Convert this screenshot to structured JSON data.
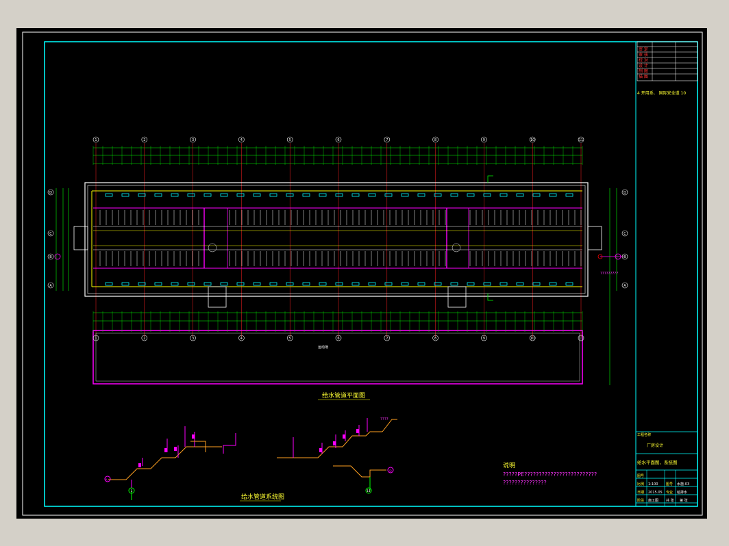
{
  "drawing": {
    "plan_title": "给水管道平面图",
    "system_title": "给水管道系统图",
    "notes_heading": "说明",
    "notes_line1": "?????PE?????????????????????????",
    "notes_line2": "???????????????",
    "pipe_label": "????",
    "exit_label": "?????????",
    "road_label": "运动场",
    "grid_columns": [
      "1",
      "2",
      "3",
      "4",
      "5",
      "6",
      "7",
      "8",
      "9",
      "10",
      "11"
    ],
    "grid_rows": [
      "D",
      "C",
      "B",
      "A"
    ],
    "system_axis_labels": [
      "1",
      "11"
    ],
    "system_side_labels": [
      "A",
      "D"
    ]
  },
  "title_block": {
    "header_note": "4 开用系、 国际安全道 10",
    "rev_rows": [
      "审  定",
      "审  核",
      "校  对",
      "设  计",
      "制  图",
      "描  图"
    ],
    "project_label": "工程名称",
    "project_name": "厂房设计",
    "drawing_name": "给水平面图、系统图",
    "scale_label": "比例",
    "scale_value": "1:100",
    "no_label": "图号",
    "no_value": "水施-03",
    "date_label": "日期",
    "date_value": "2015.05",
    "spec_label": "专业",
    "spec_value": "给排水",
    "stage_label": "阶段",
    "stage_value": "施工图",
    "sheet_label": "共  张",
    "sheet_value": "第  张"
  },
  "colors": {
    "frame": "#00ffff",
    "pipe": "#ff00ff",
    "dimension": "#00ff00",
    "wall": "#ffffff",
    "fixture": "#00ffff",
    "text": "#ffff00",
    "grid": "#ff0000"
  }
}
